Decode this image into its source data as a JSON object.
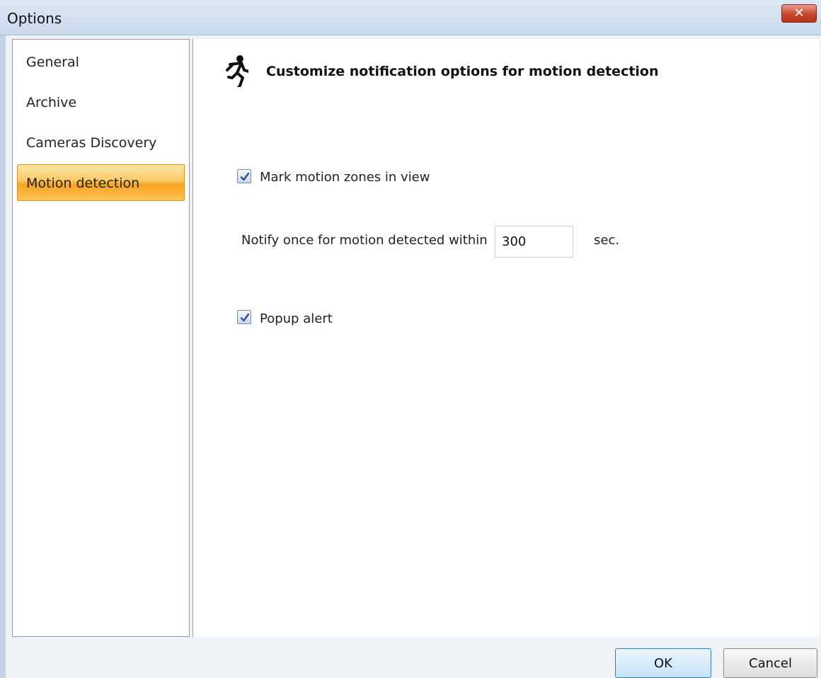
{
  "window": {
    "title": "Options",
    "close_label": "✕"
  },
  "sidebar": {
    "items": [
      {
        "label": "General",
        "selected": false
      },
      {
        "label": "Archive",
        "selected": false
      },
      {
        "label": "Cameras Discovery",
        "selected": false
      },
      {
        "label": "Motion detection",
        "selected": true
      }
    ]
  },
  "content": {
    "icon": "running-man-icon",
    "heading": "Customize notification options for motion detection",
    "mark_motion_zones": {
      "label": "Mark motion zones in view",
      "checked": true
    },
    "notify": {
      "label": "Notify once for motion detected within",
      "value": "300",
      "unit": "sec."
    },
    "popup_alert": {
      "label": "Popup alert",
      "checked": true
    }
  },
  "buttons": {
    "ok": "OK",
    "cancel": "Cancel"
  },
  "colors": {
    "selected_item": "#f7a41e",
    "titlebar": "#c9d9ec",
    "close_button": "#c9432c",
    "checkmark": "#2b4f9a",
    "ok_border": "#3c7fb1"
  }
}
